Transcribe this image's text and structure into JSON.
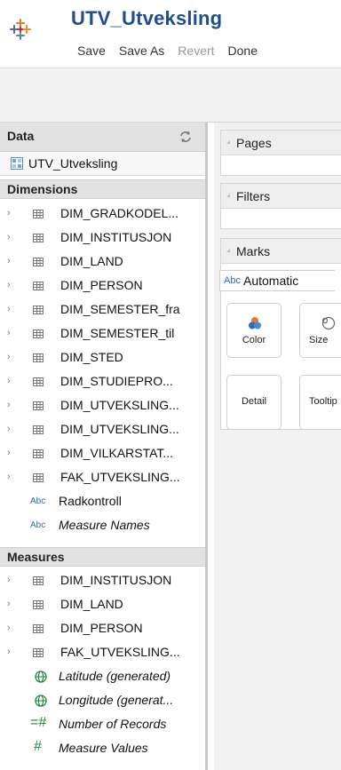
{
  "header": {
    "title": "UTV_Utveksling",
    "toolbar": {
      "save": "Save",
      "save_as": "Save As",
      "revert": "Revert",
      "done": "Done"
    }
  },
  "data_pane": {
    "label": "Data",
    "datasource": "UTV_Utveksling",
    "dimensions_label": "Dimensions",
    "dimensions": [
      "DIM_GRADKODEL...",
      "DIM_INSTITUSJON",
      "DIM_LAND",
      "DIM_PERSON",
      "DIM_SEMESTER_fra",
      "DIM_SEMESTER_til",
      "DIM_STED",
      "DIM_STUDIEPRO...",
      "DIM_UTVEKSLING...",
      "DIM_UTVEKSLING...",
      "DIM_VILKARSTAT...",
      "FAK_UTVEKSLING..."
    ],
    "dimension_fields": [
      {
        "type_icon": "Abc",
        "name": "Radkontroll"
      },
      {
        "type_icon": "Abc",
        "name": "Measure Names"
      }
    ],
    "measures_label": "Measures",
    "measure_tables": [
      "DIM_INSTITUSJON",
      "DIM_LAND",
      "DIM_PERSON",
      "FAK_UTVEKSLING..."
    ],
    "measure_fields": [
      {
        "type_icon": "globe",
        "name": "Latitude (generated)"
      },
      {
        "type_icon": "globe",
        "name": "Longitude (generat..."
      },
      {
        "type_icon": "=#",
        "name": "Number of Records"
      },
      {
        "type_icon": "#",
        "name": "Measure Values"
      }
    ]
  },
  "shelves": {
    "pages": "Pages",
    "filters": "Filters",
    "marks": "Marks",
    "mark_type_icon": "Abc",
    "mark_type": "Automatic",
    "buttons": {
      "color": "Color",
      "size": "Size",
      "detail": "Detail",
      "tooltip": "Tooltip"
    }
  },
  "colors": {
    "title": "#1f4e8c",
    "accent_blue": "#2d6bb3",
    "measure_green": "#1f8a3b"
  }
}
